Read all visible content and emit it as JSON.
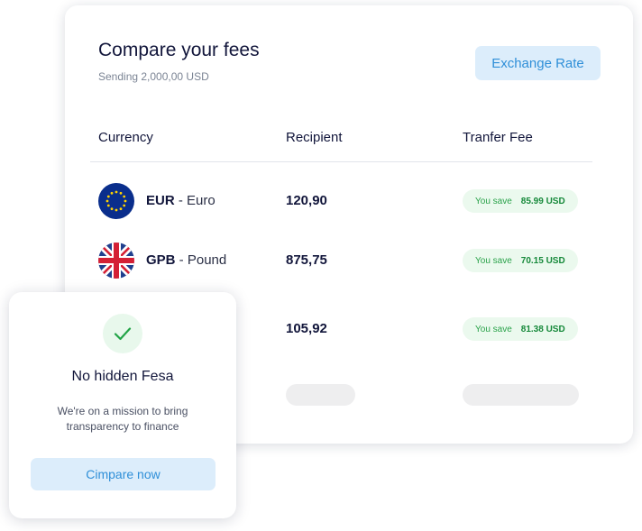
{
  "header": {
    "title": "Compare your fees",
    "subtitle": "Sending 2,000,00 USD",
    "exchange_button": "Exchange Rate"
  },
  "table": {
    "columns": [
      "Currency",
      "Recipient",
      "Tranfer Fee"
    ],
    "rows": [
      {
        "code": "EUR",
        "sep": " - ",
        "name": "Euro",
        "flag": "eu-flag",
        "amount": "120,90",
        "save_label": "You save",
        "save_value": "85.99 USD"
      },
      {
        "code": "GPB",
        "sep": " - ",
        "name": "Pound",
        "flag": "uk-flag",
        "amount": "875,75",
        "save_label": "You save",
        "save_value": "70.15 USD"
      },
      {
        "amount": "105,92",
        "save_label": "You save",
        "save_value": "81.38 USD"
      }
    ]
  },
  "promo": {
    "title": "No hidden Fesa",
    "description": "We're on a mission to bring transparency to finance",
    "button": "Cimpare now",
    "icon": "check-icon"
  },
  "colors": {
    "accent": "#2f8fd8",
    "accent_bg": "#dcedfb",
    "success": "#16893a",
    "success_bg": "#ebf9ee"
  }
}
